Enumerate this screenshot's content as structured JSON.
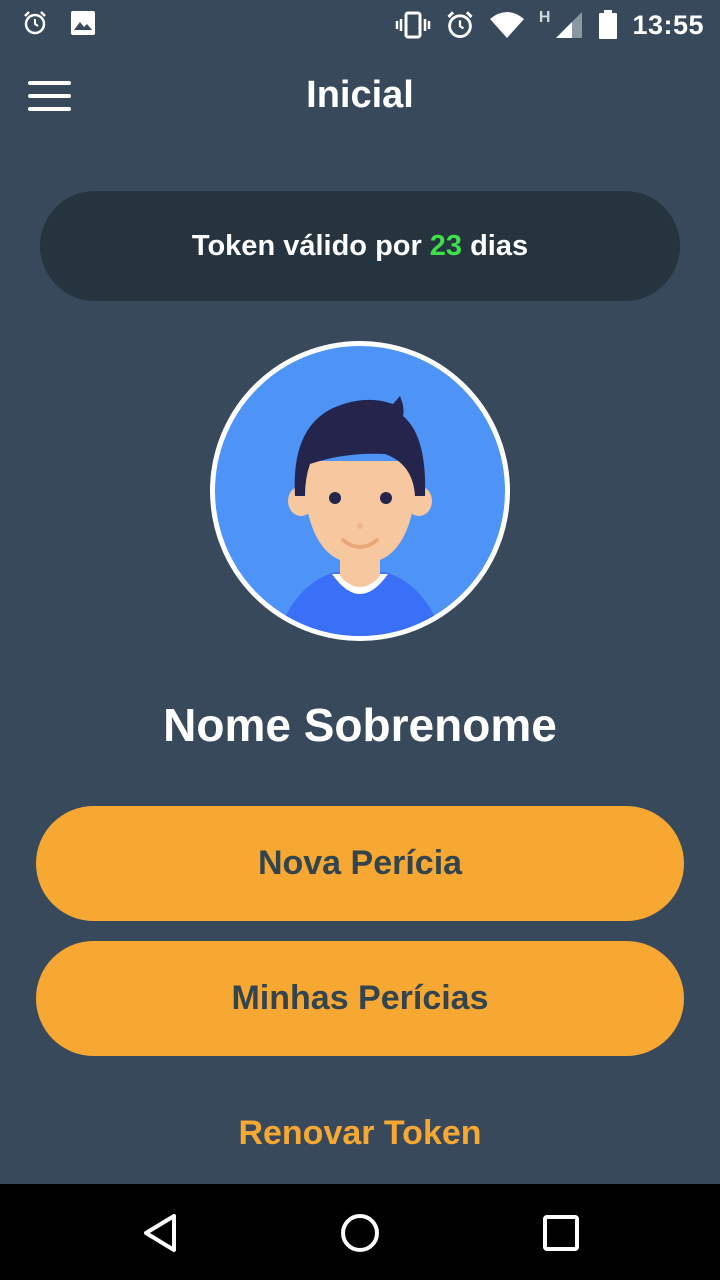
{
  "status_bar": {
    "time": "13:55",
    "network_type": "H",
    "left_icons": [
      "alarm-icon",
      "image-icon"
    ],
    "right_icons": [
      "vibrate-icon",
      "alarm-icon",
      "wifi-icon",
      "signal-icon",
      "battery-icon"
    ]
  },
  "app_bar": {
    "title": "Inicial",
    "menu_icon": "hamburger-menu-icon"
  },
  "token": {
    "prefix": "Token válido por",
    "days": "23",
    "suffix": "dias",
    "days_color": "#3de04a"
  },
  "profile": {
    "avatar_icon": "user-avatar-icon",
    "name": "Nome Sobrenome"
  },
  "actions": {
    "nova_pericia": "Nova Perícia",
    "minhas_pericias": "Minhas Perícias",
    "renovar_token": "Renovar Token"
  },
  "nav_bar": {
    "icons": [
      "back-icon",
      "home-icon",
      "recents-icon"
    ]
  },
  "colors": {
    "background": "#37495a",
    "token_pill": "#263440",
    "accent": "#f6a832",
    "avatar_bg": "#4e93f6"
  }
}
